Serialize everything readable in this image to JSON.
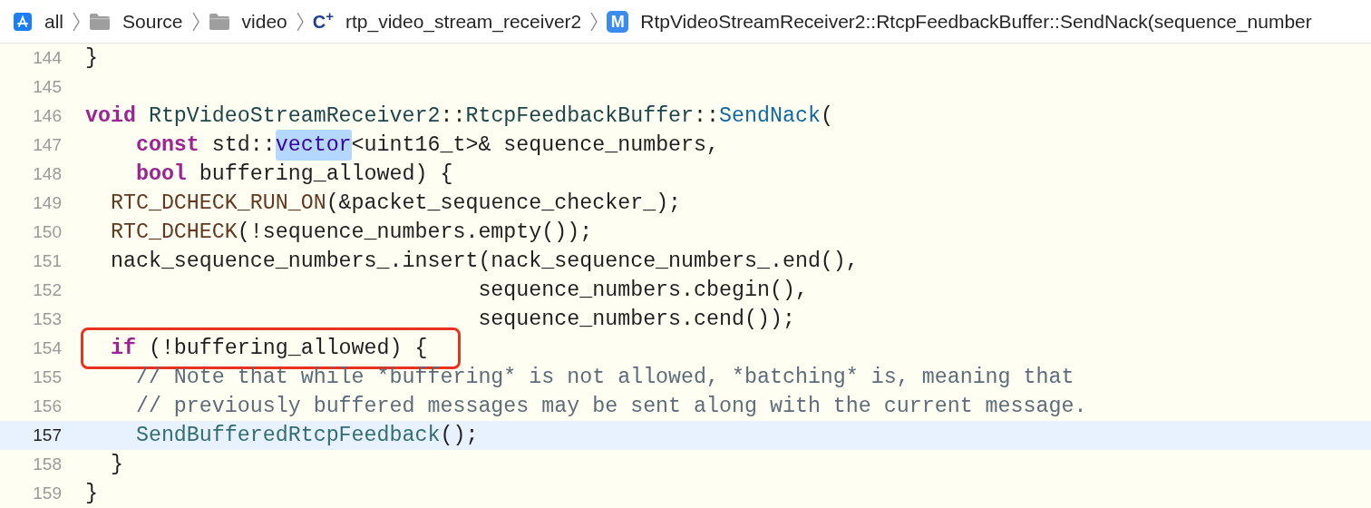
{
  "breadcrumb": [
    {
      "kind": "app",
      "label": "all"
    },
    {
      "kind": "folder",
      "label": "Source"
    },
    {
      "kind": "folder",
      "label": "video"
    },
    {
      "kind": "source",
      "icon_label": "C$^{+}$",
      "label": "rtp_video_stream_receiver2"
    },
    {
      "kind": "method",
      "icon_label": "M",
      "label": "RtpVideoStreamReceiver2::RtcpFeedbackBuffer::SendNack(sequence_number"
    }
  ],
  "lines": [
    {
      "number": "144",
      "current": false,
      "annotated": false,
      "tokens": [
        {
          "kind": "plain",
          "text": "}"
        }
      ]
    },
    {
      "number": "145",
      "current": false,
      "annotated": false
    },
    {
      "number": "146",
      "current": false,
      "annotated": false,
      "tokens": [
        {
          "kind": "keyword",
          "text": "void"
        },
        {
          "kind": "class",
          "text": " RtpVideoStreamReceiver2"
        },
        {
          "kind": "plain",
          "text": "::"
        },
        {
          "kind": "class",
          "text": "RtcpFeedbackBuffer"
        },
        {
          "kind": "plain",
          "text": "::"
        },
        {
          "kind": "declaration",
          "text": "SendNack"
        },
        {
          "kind": "plain",
          "text": "("
        }
      ]
    },
    {
      "number": "147",
      "current": false,
      "annotated": false,
      "tokens": [
        {
          "kind": "keyword",
          "text": "    const"
        },
        {
          "kind": "plain",
          "text": " std::"
        },
        {
          "kind": "library",
          "text": "vector",
          "highlighted": true
        },
        {
          "kind": "plain",
          "text": "<uint16_t>& sequence_numbers,"
        }
      ]
    },
    {
      "number": "148",
      "current": false,
      "annotated": false,
      "tokens": [
        {
          "kind": "keyword",
          "text": "    bool"
        },
        {
          "kind": "plain",
          "text": " buffering_allowed) {"
        }
      ]
    },
    {
      "number": "149",
      "current": false,
      "annotated": false,
      "tokens": [
        {
          "kind": "macro",
          "text": "  RTC_DCHECK_RUN_ON"
        },
        {
          "kind": "plain",
          "text": "(&packet_sequence_checker_);"
        }
      ]
    },
    {
      "number": "150",
      "current": false,
      "annotated": false,
      "tokens": [
        {
          "kind": "macro",
          "text": "  RTC_DCHECK"
        },
        {
          "kind": "plain",
          "text": "(!sequence_numbers.empty());"
        }
      ]
    },
    {
      "number": "151",
      "current": false,
      "annotated": false,
      "tokens": [
        {
          "kind": "plain",
          "text": "  nack_sequence_numbers_.insert(nack_sequence_numbers_.end(),"
        }
      ]
    },
    {
      "number": "152",
      "current": false,
      "annotated": false,
      "tokens": [
        {
          "kind": "plain",
          "text": "                               sequence_numbers.cbegin(),"
        }
      ]
    },
    {
      "number": "153",
      "current": false,
      "annotated": false,
      "tokens": [
        {
          "kind": "plain",
          "text": "                               sequence_numbers.cend());"
        }
      ]
    },
    {
      "number": "154",
      "current": false,
      "annotated": true,
      "tokens": [
        {
          "kind": "keyword",
          "text": "  if"
        },
        {
          "kind": "plain",
          "text": " (!buffering_allowed) {"
        }
      ]
    },
    {
      "number": "155",
      "current": false,
      "annotated": false,
      "tokens": [
        {
          "kind": "comment",
          "text": "    // Note that while *buffering* is not allowed, *batching* is, meaning that"
        }
      ]
    },
    {
      "number": "156",
      "current": false,
      "annotated": false,
      "tokens": [
        {
          "kind": "comment",
          "text": "    // previously buffered messages may be sent along with the current message."
        }
      ]
    },
    {
      "number": "157",
      "current": true,
      "annotated": false,
      "tokens": [
        {
          "kind": "function",
          "text": "    SendBufferedRtcpFeedback"
        },
        {
          "kind": "plain",
          "text": "();"
        }
      ]
    },
    {
      "number": "158",
      "current": false,
      "annotated": false,
      "tokens": [
        {
          "kind": "plain",
          "text": "  }"
        }
      ]
    },
    {
      "number": "159",
      "current": false,
      "annotated": false,
      "tokens": [
        {
          "kind": "plain",
          "text": "}"
        }
      ]
    }
  ]
}
